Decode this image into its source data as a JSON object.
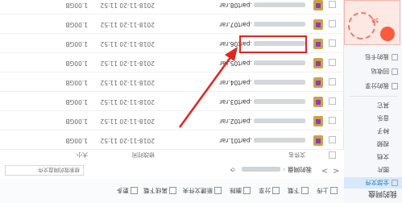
{
  "sidebar": {
    "title": "我的网盘",
    "items": [
      {
        "label": "全部文件",
        "active": true
      },
      {
        "label": "图片"
      },
      {
        "label": "文档"
      },
      {
        "label": "视频"
      },
      {
        "label": "种子"
      },
      {
        "label": "音乐"
      },
      {
        "label": "其它"
      },
      {
        "label": "我的分享"
      },
      {
        "label": "回收站"
      },
      {
        "label": "我的卡包"
      }
    ],
    "ad_text": "58"
  },
  "toolbar": {
    "buttons": [
      {
        "label": "上传",
        "icon": "upload-icon"
      },
      {
        "label": "下载",
        "icon": "download-icon"
      },
      {
        "label": "分享",
        "icon": "share-icon"
      },
      {
        "label": "删除",
        "icon": "delete-icon"
      },
      {
        "label": "新建文件夹",
        "icon": "new-folder-icon"
      },
      {
        "label": "离线下载",
        "icon": "offline-download-icon"
      },
      {
        "label": "更多",
        "icon": "more-icon"
      }
    ]
  },
  "nav": {
    "back": "<",
    "forward": ">",
    "refresh": "⟳",
    "root": "我的网盘",
    "search_placeholder": "搜索我的网盘文件"
  },
  "table": {
    "headers": {
      "name": "文件名",
      "date": "修改时间",
      "size": "大小"
    },
    "rows": [
      {
        "name": ".part01.rar",
        "date": "2018-11-20 11:52",
        "size": "1.00GB"
      },
      {
        "name": ".part02.rar",
        "date": "2018-11-20 11:52",
        "size": "1.00GB"
      },
      {
        "name": ".part03.rar",
        "date": "2018-11-20 11:52",
        "size": "1.00GB"
      },
      {
        "name": ".part04.rar",
        "date": "2018-11-20 11:52",
        "size": "1.00GB"
      },
      {
        "name": ".part05.rar",
        "date": "2018-11-20 11:52",
        "size": "1.00GB"
      },
      {
        "name": ".part06.rar",
        "date": "2018-11-20 11:52",
        "size": "1.00GB"
      },
      {
        "name": ".part07.rar",
        "date": "2018-11-20 11:52",
        "size": "1.00GB"
      },
      {
        "name": ".part08.rar",
        "date": "2018-11-20 11:52",
        "size": "1.00GB"
      }
    ]
  },
  "colors": {
    "highlight": "#e0261d",
    "accent": "#1a73c8"
  }
}
